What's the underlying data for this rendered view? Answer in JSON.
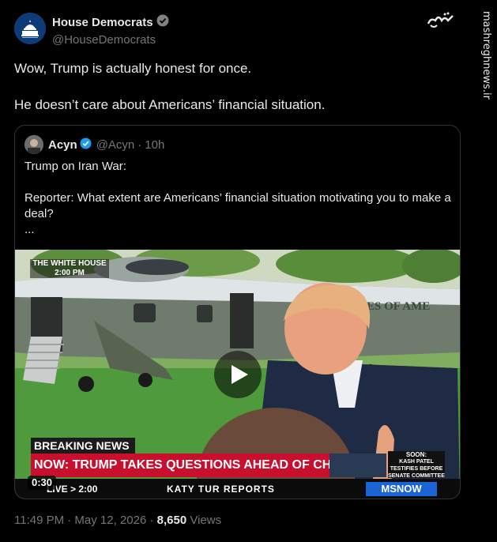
{
  "tweet": {
    "author_name": "House Democrats",
    "author_handle": "@HouseDemocrats",
    "text_line1": "Wow, Trump is actually honest for once.",
    "text_line2": "He doesn’t care about Americans’ financial situation.",
    "timestamp": "11:49 PM · May 12, 2026 · ",
    "views_count": "8,650",
    "views_label": " Views"
  },
  "quoted_tweet": {
    "author_name": "Acyn",
    "author_handle": "@Acyn",
    "separator": "·",
    "age": "10h",
    "line1": "Trump on Iran War:",
    "line2": "Reporter: What extent are Americans’ financial situation motivating you to make a deal?",
    "line3": "..."
  },
  "video": {
    "duration": "0:30",
    "overlay_location": "THE WHITE HOUSE",
    "overlay_time": "2:00 PM",
    "breaking_label": "BREAKING NEWS",
    "headline": "NOW: TRUMP TAKES QUESTIONS AHEAD OF CHINA DEPARTURE",
    "soon_title": "SOON:",
    "soon_line1": "KASH PATEL",
    "soon_line2": "TESTIFIES BEFORE",
    "soon_line3": "SENATE COMMITTEE",
    "live_time": "LIVE > 2:00",
    "show_name": "KATY TUR REPORTS",
    "network": "MSNOW",
    "helicopter_text": "ES OF AME"
  },
  "watermark": {
    "logo_text": "مشرق",
    "url": "mashreghnews.ir"
  },
  "colors": {
    "background": "#000000",
    "text": "#e7e9ea",
    "muted": "#71767b",
    "verified": "#1d9bf0",
    "border": "#2f3336",
    "headline_red": "#c8102e"
  }
}
